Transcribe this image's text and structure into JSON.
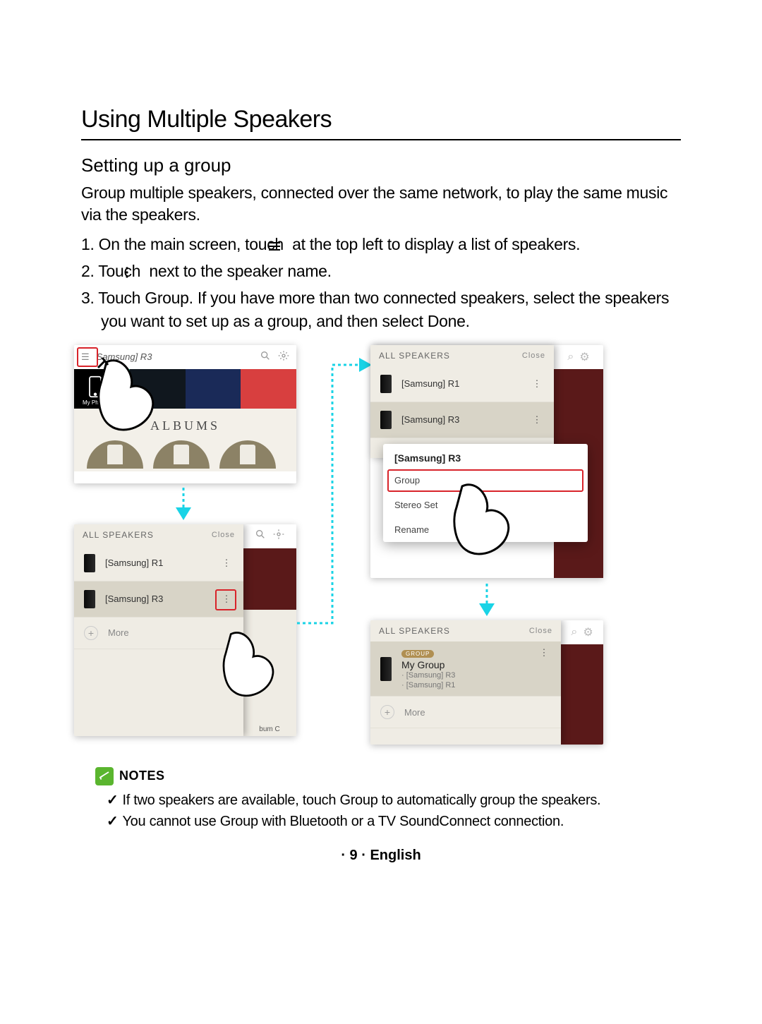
{
  "title": "Using Multiple Speakers",
  "subtitle": "Setting up a group",
  "intro": "Group multiple speakers, connected over the same network, to play the same music via the speakers.",
  "steps": {
    "s1a": "1.  On the main screen, touch ",
    "s1b": " at the top left to display a list of speakers.",
    "s2a": "2.  Touch ",
    "s2b": " next to the speaker name.",
    "s3a": "3.  Touch ",
    "s3_group": "Group",
    "s3b": ". If you have more than two connected speakers, select the speakers you want to set up as a group, and then select ",
    "s3_done": "Done",
    "s3c": "."
  },
  "shot1": {
    "title": "Samsung] R3",
    "myphone": "My Phone",
    "albums": "ALBUMS"
  },
  "drawer": {
    "header": "ALL SPEAKERS",
    "close": "Close",
    "r1": "[Samsung] R1",
    "r3": "[Samsung] R3",
    "more": "More",
    "albumc": "bum C"
  },
  "popup": {
    "title": "[Samsung] R3",
    "group": "Group",
    "stereo": "Stereo Set",
    "rename": "Rename"
  },
  "grouped": {
    "badge": "GROUP",
    "name": "My Group",
    "line1": "· [Samsung] R3",
    "line2": "· [Samsung] R1"
  },
  "notes": {
    "heading": "NOTES",
    "n1a": "If two speakers are available, touch ",
    "n1_group": "Group",
    "n1b": " to automatically group the speakers.",
    "n2a": "You cannot use ",
    "n2_group": "Group",
    "n2b": " with Bluetooth or a TV SoundConnect connection."
  },
  "footer": "·  9  ·  English"
}
